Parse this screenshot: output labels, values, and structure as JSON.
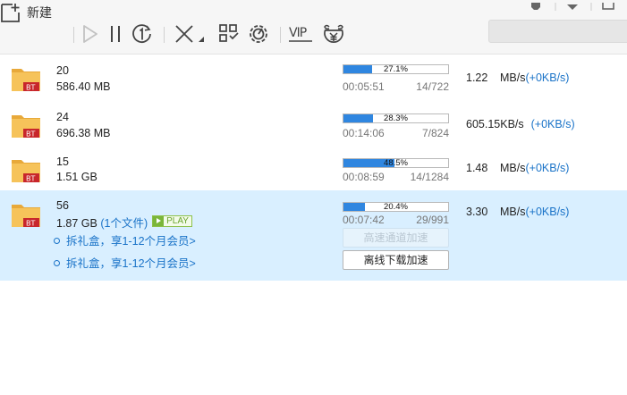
{
  "toolbar": {
    "new_label": "新建",
    "icons": [
      "new-task-icon",
      "play-icon",
      "pause-icon",
      "speed-limit-icon",
      "delete-icon",
      "apps-icon",
      "settings-icon",
      "vip-icon",
      "gift-box-icon"
    ],
    "vip_text": "VIP"
  },
  "colors": {
    "accent": "#2f86e0",
    "link": "#1a73c8",
    "selected_row": "#d9efff",
    "folder": "#f6c35a",
    "bt_badge": "#c8262b"
  },
  "tasks": [
    {
      "name": "20",
      "size": "586.40 MB",
      "progress_pct": 27.1,
      "progress_label": "27.1%",
      "elapsed": "00:05:51",
      "pieces": "14/722",
      "speed": "1.22",
      "speed_unit": "MB/s",
      "speed_extra": "(+0KB/s)",
      "badge": "BT"
    },
    {
      "name": "24",
      "size": "696.38 MB",
      "progress_pct": 28.3,
      "progress_label": "28.3%",
      "elapsed": "00:14:06",
      "pieces": "7/824",
      "speed": "605.15",
      "speed_unit": "KB/s",
      "speed_extra": "(+0KB/s)",
      "badge": "BT"
    },
    {
      "name": "15",
      "size": "1.51 GB",
      "progress_pct": 48.5,
      "progress_label": "48.5%",
      "elapsed": "00:08:59",
      "pieces": "14/1284",
      "speed": "1.48",
      "speed_unit": "MB/s",
      "speed_extra": "(+0KB/s)",
      "badge": "BT"
    },
    {
      "name": "56",
      "size": "1.87 GB",
      "file_count": "(1个文件)",
      "play_label": "PLAY",
      "progress_pct": 20.4,
      "progress_label": "20.4%",
      "elapsed": "00:07:42",
      "pieces": "29/991",
      "speed": "3.30",
      "speed_unit": "MB/s",
      "speed_extra": "(+0KB/s)",
      "badge": "BT",
      "promos": [
        "拆礼盒，享1-12个月会员>",
        "拆礼盒，享1-12个月会员>"
      ],
      "accel_button": "高速通道加速",
      "offline_button": "离线下载加速"
    }
  ]
}
